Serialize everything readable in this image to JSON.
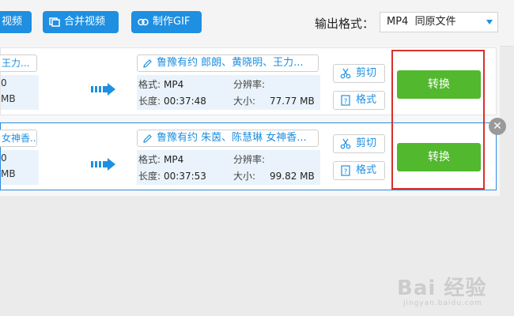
{
  "toolbar": {
    "buttons": [
      {
        "label": "视频",
        "icon": "video-icon"
      },
      {
        "label": "合并视频",
        "icon": "merge-icon"
      },
      {
        "label": "制作GIF",
        "icon": "gif-icon"
      }
    ],
    "output_label": "输出格式：",
    "output_value": "MP4  同原文件"
  },
  "rows": [
    {
      "source_name": "王力...",
      "source_line1": "0",
      "source_line2": "MB",
      "output_name": "鲁豫有约 郎朗、黄晓明、王力...",
      "format_label": "格式:",
      "format": "MP4",
      "resolution_label": "分辨率:",
      "resolution": "",
      "duration_label": "长度:",
      "duration": "00:37:48",
      "size_label": "大小:",
      "size": "77.77 MB",
      "cut_label": "剪切",
      "format_btn_label": "格式",
      "convert_label": "转换"
    },
    {
      "source_name": "女神香...",
      "source_line1": "0",
      "source_line2": "MB",
      "output_name": "鲁豫有约 朱茵、陈慧琳 女神香...",
      "format_label": "格式:",
      "format": "MP4",
      "resolution_label": "分辨率:",
      "resolution": "",
      "duration_label": "长度:",
      "duration": "00:37:53",
      "size_label": "大小:",
      "size": "99.82 MB",
      "cut_label": "剪切",
      "format_btn_label": "格式",
      "convert_label": "转换"
    }
  ],
  "watermark": {
    "top": "Bai 经验",
    "bottom": "jingyan.baidu.com"
  },
  "colors": {
    "accent": "#1e8fe1",
    "convert": "#52b82e",
    "highlight": "#d9302b"
  }
}
